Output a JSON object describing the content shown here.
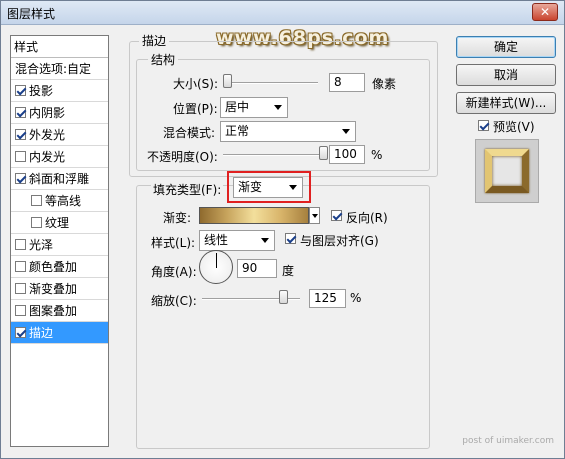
{
  "window": {
    "title": "图层样式",
    "close_label": "✕"
  },
  "watermark": "www.68ps.com",
  "watermark2": "post of uimaker.com",
  "left_list": {
    "header": "样式",
    "items": [
      {
        "label": "混合选项:自定",
        "checkbox": false,
        "checked": false,
        "sub": false,
        "selected": false
      },
      {
        "label": "投影",
        "checkbox": true,
        "checked": true,
        "sub": false,
        "selected": false
      },
      {
        "label": "内阴影",
        "checkbox": true,
        "checked": true,
        "sub": false,
        "selected": false
      },
      {
        "label": "外发光",
        "checkbox": true,
        "checked": true,
        "sub": false,
        "selected": false
      },
      {
        "label": "内发光",
        "checkbox": true,
        "checked": false,
        "sub": false,
        "selected": false
      },
      {
        "label": "斜面和浮雕",
        "checkbox": true,
        "checked": true,
        "sub": false,
        "selected": false
      },
      {
        "label": "等高线",
        "checkbox": true,
        "checked": false,
        "sub": true,
        "selected": false
      },
      {
        "label": "纹理",
        "checkbox": true,
        "checked": false,
        "sub": true,
        "selected": false
      },
      {
        "label": "光泽",
        "checkbox": true,
        "checked": false,
        "sub": false,
        "selected": false
      },
      {
        "label": "颜色叠加",
        "checkbox": true,
        "checked": false,
        "sub": false,
        "selected": false
      },
      {
        "label": "渐变叠加",
        "checkbox": true,
        "checked": false,
        "sub": false,
        "selected": false
      },
      {
        "label": "图案叠加",
        "checkbox": true,
        "checked": false,
        "sub": false,
        "selected": false
      },
      {
        "label": "描边",
        "checkbox": true,
        "checked": true,
        "sub": false,
        "selected": true
      }
    ]
  },
  "stroke": {
    "section_title": "描边",
    "structure_title": "结构",
    "size_label": "大小(S):",
    "size_value": "8",
    "size_unit": "像素",
    "size_level": 0.04,
    "position_label": "位置(P):",
    "position_value": "居中",
    "blend_label": "混合模式:",
    "blend_value": "正常",
    "opacity_label": "不透明度(O):",
    "opacity_value": "100",
    "opacity_unit": "%",
    "opacity_level": 1.0
  },
  "fill": {
    "type_label": "填充类型(F):",
    "type_value": "渐变",
    "gradient_label": "渐变:",
    "reverse_label": "反向(R)",
    "reverse_checked": true,
    "style_label": "样式(L):",
    "style_value": "线性",
    "align_label": "与图层对齐(G)",
    "align_checked": true,
    "angle_label": "角度(A):",
    "angle_value": "90",
    "angle_unit": "度",
    "scale_label": "缩放(C):",
    "scale_value": "125",
    "scale_unit": "%",
    "scale_level": 0.83
  },
  "buttons": {
    "ok": "确定",
    "cancel": "取消",
    "new_style": "新建样式(W)...",
    "preview_label": "预览(V)",
    "preview_checked": true
  },
  "colors": {
    "selection": "#3399ff",
    "highlight_box": "#e02020"
  }
}
